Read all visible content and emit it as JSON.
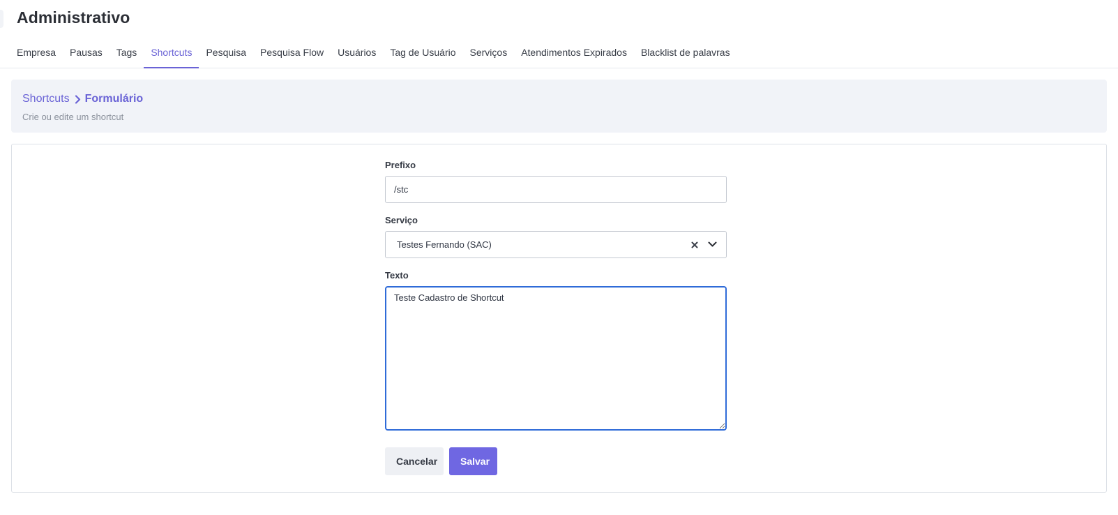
{
  "header": {
    "title": "Administrativo"
  },
  "tabs": [
    {
      "label": "Empresa",
      "active": false
    },
    {
      "label": "Pausas",
      "active": false
    },
    {
      "label": "Tags",
      "active": false
    },
    {
      "label": "Shortcuts",
      "active": true
    },
    {
      "label": "Pesquisa",
      "active": false
    },
    {
      "label": "Pesquisa Flow",
      "active": false
    },
    {
      "label": "Usuários",
      "active": false
    },
    {
      "label": "Tag de Usuário",
      "active": false
    },
    {
      "label": "Serviços",
      "active": false
    },
    {
      "label": "Atendimentos Expirados",
      "active": false
    },
    {
      "label": "Blacklist de palavras",
      "active": false
    }
  ],
  "breadcrumb": {
    "parent": "Shortcuts",
    "current": "Formulário",
    "subtitle": "Crie ou edite um shortcut"
  },
  "form": {
    "prefix": {
      "label": "Prefixo",
      "value": "/stc"
    },
    "service": {
      "label": "Serviço",
      "value": "Testes Fernando (SAC)"
    },
    "text": {
      "label": "Texto",
      "value": "Teste Cadastro de Shortcut"
    },
    "cancel_label": "Cancelar",
    "save_label": "Salvar"
  },
  "colors": {
    "accent": "#6a63d6",
    "focus_border": "#2f6bd8",
    "panel_bg": "#f1f3f8"
  },
  "icons": {
    "breadcrumb_separator": "chevron-right-icon",
    "select_clear": "clear-icon",
    "select_open": "chevron-down-icon"
  }
}
